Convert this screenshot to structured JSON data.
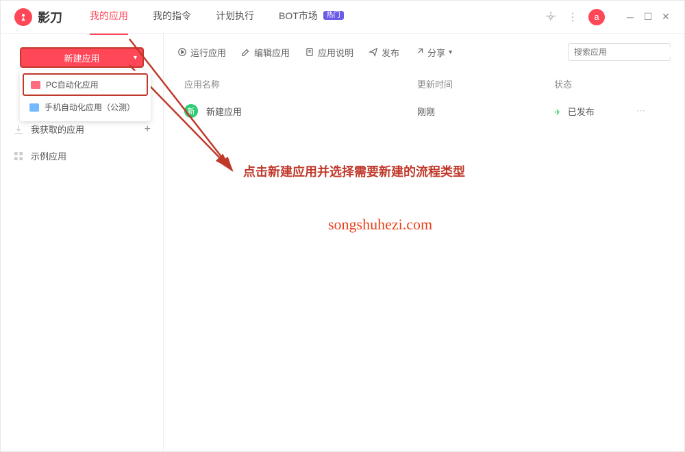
{
  "header": {
    "app_name": "影刀",
    "tabs": [
      {
        "label": "我的应用",
        "active": true
      },
      {
        "label": "我的指令",
        "active": false
      },
      {
        "label": "计划执行",
        "active": false
      },
      {
        "label": "BOT市场",
        "active": false,
        "badge": "热门"
      }
    ],
    "avatar_letter": "a"
  },
  "sidebar": {
    "new_button": "新建应用",
    "dropdown": {
      "pc_option": "PC自动化应用",
      "mobile_option": "手机自动化应用（公测）"
    },
    "items": [
      {
        "label": "我获取的应用",
        "has_plus": true
      },
      {
        "label": "示例应用",
        "has_plus": false
      }
    ]
  },
  "toolbar": {
    "run": "运行应用",
    "edit": "编辑应用",
    "desc": "应用说明",
    "publish": "发布",
    "share": "分享",
    "search_placeholder": "搜索应用"
  },
  "table": {
    "headers": {
      "name": "应用名称",
      "time": "更新时间",
      "status": "状态"
    },
    "rows": [
      {
        "badge": "新",
        "name": "新建应用",
        "time": "刚刚",
        "status": "已发布"
      }
    ]
  },
  "annotations": {
    "instruction": "点击新建应用并选择需要新建的流程类型",
    "watermark": "songshuhezi.com"
  }
}
